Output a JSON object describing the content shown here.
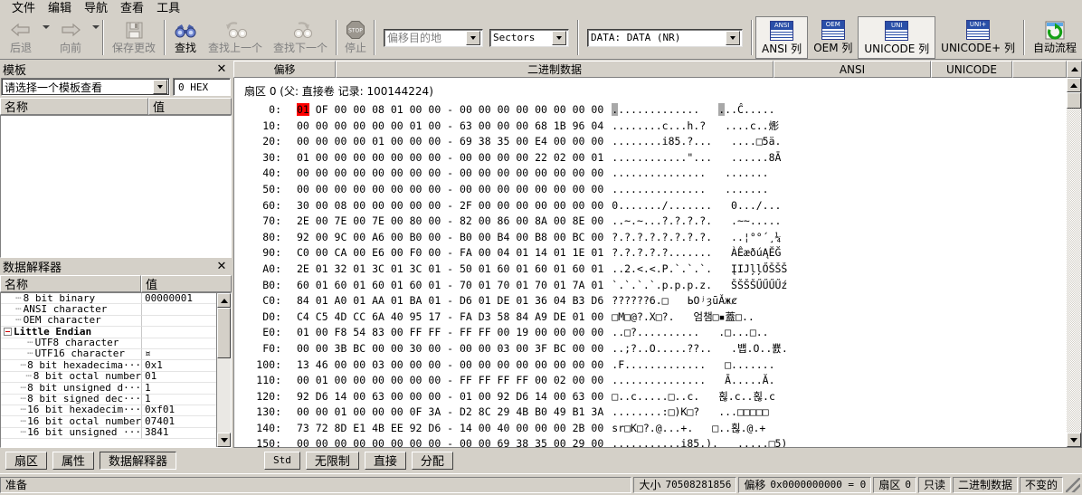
{
  "menu": {
    "items": [
      {
        "label": "文件",
        "name": "menu-file"
      },
      {
        "label": "编辑",
        "name": "menu-edit"
      },
      {
        "label": "导航",
        "name": "menu-navigate"
      },
      {
        "label": "查看",
        "name": "menu-view"
      },
      {
        "label": "工具",
        "name": "menu-tools"
      }
    ]
  },
  "toolbar": {
    "back": "后退",
    "forward": "向前",
    "save_changes": "保存更改",
    "find": "查找",
    "find_prev": "查找上一个",
    "find_next": "查找下一个",
    "stop": "停止",
    "stop_icon_text": "STOP",
    "offset_dest": "偏移目的地",
    "sectors": "Sectors",
    "data_mode": "DATA: DATA (NR)",
    "ansi_col": "ANSI 列",
    "oem_col": "OEM 列",
    "unicode_col": "UNICODE 列",
    "unicode_plus_col": "UNICODE+ 列",
    "auto_flow": "自动流程",
    "icon_labels": {
      "ansi": "ANSI",
      "oem": "OEM",
      "uni": "UNI",
      "uniplus": "UNI+"
    }
  },
  "template_pane": {
    "title": "模板",
    "close": "✕",
    "combo_value": "请选择一个模板查看",
    "hex_value": "0 HEX",
    "col_name": "名称",
    "col_value": "值"
  },
  "data_interpreter": {
    "title": "数据解释器",
    "close": "✕",
    "col_name": "名称",
    "col_value": "值",
    "rows": [
      {
        "indent": 1,
        "label": "8 bit binary",
        "value": "00000001",
        "bold": false,
        "expander": false
      },
      {
        "indent": 1,
        "label": "ANSI character",
        "value": "",
        "bold": false,
        "expander": false
      },
      {
        "indent": 1,
        "label": "OEM character",
        "value": "",
        "bold": false,
        "expander": false
      },
      {
        "indent": 0,
        "label": "Little Endian",
        "value": "",
        "bold": true,
        "expander": true
      },
      {
        "indent": 2,
        "label": "UTF8 character",
        "value": "",
        "bold": false,
        "expander": false
      },
      {
        "indent": 2,
        "label": "UTF16 character",
        "value": "¤",
        "bold": false,
        "expander": false
      },
      {
        "indent": 2,
        "label": "8 bit hexadecima···",
        "value": "0x1",
        "bold": false,
        "expander": false
      },
      {
        "indent": 2,
        "label": "8 bit octal number",
        "value": "01",
        "bold": false,
        "expander": false
      },
      {
        "indent": 2,
        "label": "8 bit unsigned d···",
        "value": "1",
        "bold": false,
        "expander": false
      },
      {
        "indent": 2,
        "label": "8 bit signed dec···",
        "value": "1",
        "bold": false,
        "expander": false
      },
      {
        "indent": 2,
        "label": "16 bit hexadecim···",
        "value": "0xf01",
        "bold": false,
        "expander": false
      },
      {
        "indent": 2,
        "label": "16 bit octal number",
        "value": "07401",
        "bold": false,
        "expander": false
      },
      {
        "indent": 2,
        "label": "16 bit unsigned ···",
        "value": "3841",
        "bold": false,
        "expander": false
      }
    ]
  },
  "hex_view": {
    "headers": {
      "offset": "偏移",
      "binary": "二进制数据",
      "ansi": "ANSI",
      "unicode": "UNICODE"
    },
    "sector_line": "扇区 0 (父: 直接卷 记录: 100144224)",
    "selected_byte": "01",
    "rows": [
      {
        "offset": "0",
        "bytes_left": "OF 00 00 08 01 00 00",
        "bytes_right": "00 00 00 00 00 00 00 00",
        "ansi": ".............",
        "unicode": "..Ĉ....."
      },
      {
        "offset": "10",
        "bytes_left": "00 00 00 00 00 00 01 00",
        "bytes_right": "63 00 00 00 68 1B 96 04",
        "ansi": "........c...h.?",
        "unicode": "....c..烿"
      },
      {
        "offset": "20",
        "bytes_left": "00 00 00 00 01 00 00 00",
        "bytes_right": "69 38 35 00 E4 00 00 00",
        "ansi": "........i85.?...",
        "unicode": "....□5ä."
      },
      {
        "offset": "30",
        "bytes_left": "01 00 00 00 00 00 00 00",
        "bytes_right": "00 00 00 00 22 02 00 01",
        "ansi": "............\"...",
        "unicode": "......8Ā"
      },
      {
        "offset": "40",
        "bytes_left": "00 00 00 00 00 00 00 00",
        "bytes_right": "00 00 00 00 00 00 00 00",
        "ansi": "...............",
        "unicode": "......."
      },
      {
        "offset": "50",
        "bytes_left": "00 00 00 00 00 00 00 00",
        "bytes_right": "00 00 00 00 00 00 00 00",
        "ansi": "...............",
        "unicode": "......."
      },
      {
        "offset": "60",
        "bytes_left": "30 00 08 00 00 00 00 00",
        "bytes_right": "2F 00 00 00 00 00 00 00",
        "ansi": "0......./.......",
        "unicode": "0.../..."
      },
      {
        "offset": "70",
        "bytes_left": "2E 00 7E 00 7E 00 80 00",
        "bytes_right": "82 00 86 00 8A 00 8E 00",
        "ansi": "..~.~...?.?.?.?.",
        "unicode": ".~~....."
      },
      {
        "offset": "80",
        "bytes_left": "92 00 9C 00 A6 00 B0 00",
        "bytes_right": "B0 00 B4 00 B8 00 BC 00",
        "ansi": "?.?.?.?.?.?.?.?.",
        "unicode": "..¦°°´¸¼"
      },
      {
        "offset": "90",
        "bytes_left": "C0 00 CA 00 E6 00 F0 00",
        "bytes_right": "FA 00 04 01 14 01 1E 01",
        "ansi": "?.?.?.?.?.......",
        "unicode": "ÀÊæðúĄĔĞ"
      },
      {
        "offset": "A0",
        "bytes_left": "2E 01 32 01 3C 01 3C 01",
        "bytes_right": "50 01 60 01 60 01 60 01",
        "ansi": "..2.<.<.P.`.`.`.",
        "unicode": "ĮIJļļŐŠŠŠ"
      },
      {
        "offset": "B0",
        "bytes_left": "60 01 60 01 60 01 60 01",
        "bytes_right": "70 01 70 01 70 01 7A 01",
        "ansi": "`.`.`.`.p.p.p.z.",
        "unicode": "ŠŠŠŠŰŰŰŰź"
      },
      {
        "offset": "C0",
        "bytes_left": "84 01 A0 01 AA 01 BA 01",
        "bytes_right": "D6 01 DE 01 36 04 B3 D6",
        "ansi": "??????6.□",
        "unicode": "ЬОʲȝūǍжȼ"
      },
      {
        "offset": "D0",
        "bytes_left": "C4 C5 4D CC 6A 40 95 17",
        "bytes_right": "FA D3 58 84 A9 DE 01 00",
        "ansi": "□M□@?.X□?.",
        "unicode": "엄챔□▪蓋□.."
      },
      {
        "offset": "E0",
        "bytes_left": "01 00 F8 54 83 00 FF FF",
        "bytes_right": "FF FF 00 19 00 00 00 00",
        "ansi": "..□?..........",
        "unicode": ".□...□.."
      },
      {
        "offset": "F0",
        "bytes_left": "00 00 3B BC 00 00 30 00",
        "bytes_right": "00 00 03 00 3F BC 00 00",
        "ansi": "..;?..O.....??..",
        "unicode": ".뱹.O..뾼."
      },
      {
        "offset": "100",
        "bytes_left": "13 46 00 00 03 00 00 00",
        "bytes_right": "00 00 00 00 00 00 00 00",
        "ansi": ".F.............",
        "unicode": "□......."
      },
      {
        "offset": "110",
        "bytes_left": "00 01 00 00 00 00 00 00",
        "bytes_right": "FF FF FF FF 00 02 00 00",
        "ansi": "...............",
        "unicode": "Ā.....Ă."
      },
      {
        "offset": "120",
        "bytes_left": "92 D6 14 00 63 00 00 00",
        "bytes_right": "01 00 92 D6 14 00 63 00",
        "ansi": "□..c.....□..c.",
        "unicode": "횒.c..횒.c"
      },
      {
        "offset": "130",
        "bytes_left": "00 00 01 00 00 00 0F 3A",
        "bytes_right": "D2 8C 29 4B B0 49 B1 3A",
        "ansi": "........:□)K□?",
        "unicode": "...□□□□□"
      },
      {
        "offset": "140",
        "bytes_left": "73 72 8D E1 4B EE 92 D6",
        "bytes_right": "14 00 40 00 00 00 2B 00",
        "ansi": "sr□K□?.@...+.",
        "unicode": "□..횒.@.+"
      },
      {
        "offset": "150",
        "bytes_left": "00 00 00 00 00 00 00 00",
        "bytes_right": "00 00 69 38 35 00 29 00",
        "ansi": "...........i85.).",
        "unicode": ".....□5)"
      }
    ]
  },
  "bottom_tabs": {
    "left": [
      {
        "label": "扇区",
        "pressed": false
      },
      {
        "label": "属性",
        "pressed": false
      },
      {
        "label": "数据解释器",
        "pressed": true
      }
    ],
    "right": [
      {
        "label": "Std",
        "mono": true
      },
      {
        "label": "无限制",
        "mono": false
      },
      {
        "label": "直接",
        "mono": false
      },
      {
        "label": "分配",
        "mono": false
      }
    ]
  },
  "status_bar": {
    "message": "准备",
    "size_label": "大小",
    "size_value": "70508281856",
    "offset_label": "偏移",
    "offset_value": "0x0000000000 = 0",
    "sector_label": "扇区",
    "sector_value": "0",
    "readonly": "只读",
    "mode": "二进制数据",
    "unchanged": "不变的"
  }
}
